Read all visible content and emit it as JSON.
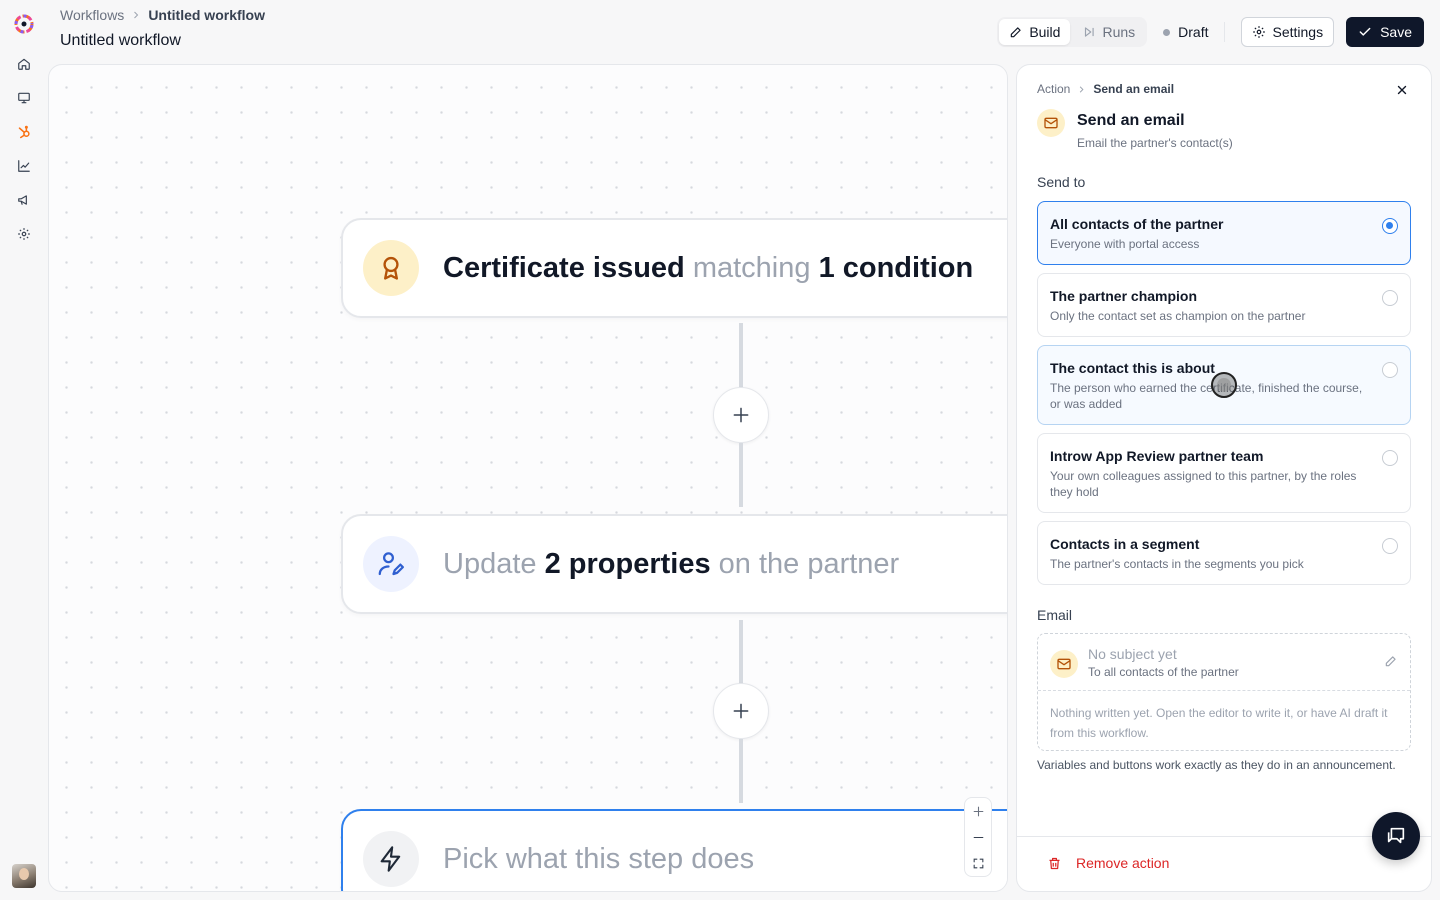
{
  "header": {
    "breadcrumb_root": "Workflows",
    "breadcrumb_current": "Untitled workflow",
    "title": "Untitled workflow",
    "tabs": [
      {
        "label": "Build",
        "active": true
      },
      {
        "label": "Runs",
        "active": false
      }
    ],
    "status": "Draft",
    "settings_label": "Settings",
    "save_label": "Save"
  },
  "sidebar": {
    "icons": [
      "home-icon",
      "monitor-icon",
      "hubspot-icon",
      "chart-icon",
      "megaphone-icon",
      "gear-icon"
    ]
  },
  "canvas": {
    "nodes": [
      {
        "icon": "award-icon",
        "bold1": "Certificate issued",
        "light1": " matching ",
        "bold2": "1 condition"
      },
      {
        "light1": "Update ",
        "bold1": "2 properties",
        "light2": " on the partner",
        "icon": "user-edit-icon"
      },
      {
        "icon": "lightning-icon",
        "light1": "Pick what this step does",
        "selected": true
      }
    ]
  },
  "panel": {
    "breadcrumb_root": "Action",
    "breadcrumb_current": "Send an email",
    "title": "Send an email",
    "subtitle": "Email the partner's contact(s)",
    "send_to_label": "Send to",
    "options": [
      {
        "title": "All contacts of the partner",
        "desc": "Everyone with portal access",
        "selected": true
      },
      {
        "title": "The partner champion",
        "desc": "Only the contact set as champion on the partner",
        "selected": false
      },
      {
        "title": "The contact this is about",
        "desc": "The person who earned the certificate, finished the course, or was added",
        "selected": false
      },
      {
        "title": "Introw App Review partner team",
        "desc": "Your own colleagues assigned to this partner, by the roles they hold",
        "selected": false
      },
      {
        "title": "Contacts in a segment",
        "desc": "The partner's contacts in the segments you pick",
        "selected": false
      }
    ],
    "email_label": "Email",
    "email": {
      "subject": "No subject yet",
      "to": "To all contacts of the partner",
      "body": "Nothing written yet. Open the editor to write it, or have AI draft it from this workflow."
    },
    "note": "Variables and buttons work exactly as they do in an announcement.",
    "remove_label": "Remove action"
  },
  "colors": {
    "accent": "#2f80ed",
    "dark": "#0f172a",
    "danger": "#dc2626",
    "warm_icon_bg": "#fdf0c8"
  }
}
